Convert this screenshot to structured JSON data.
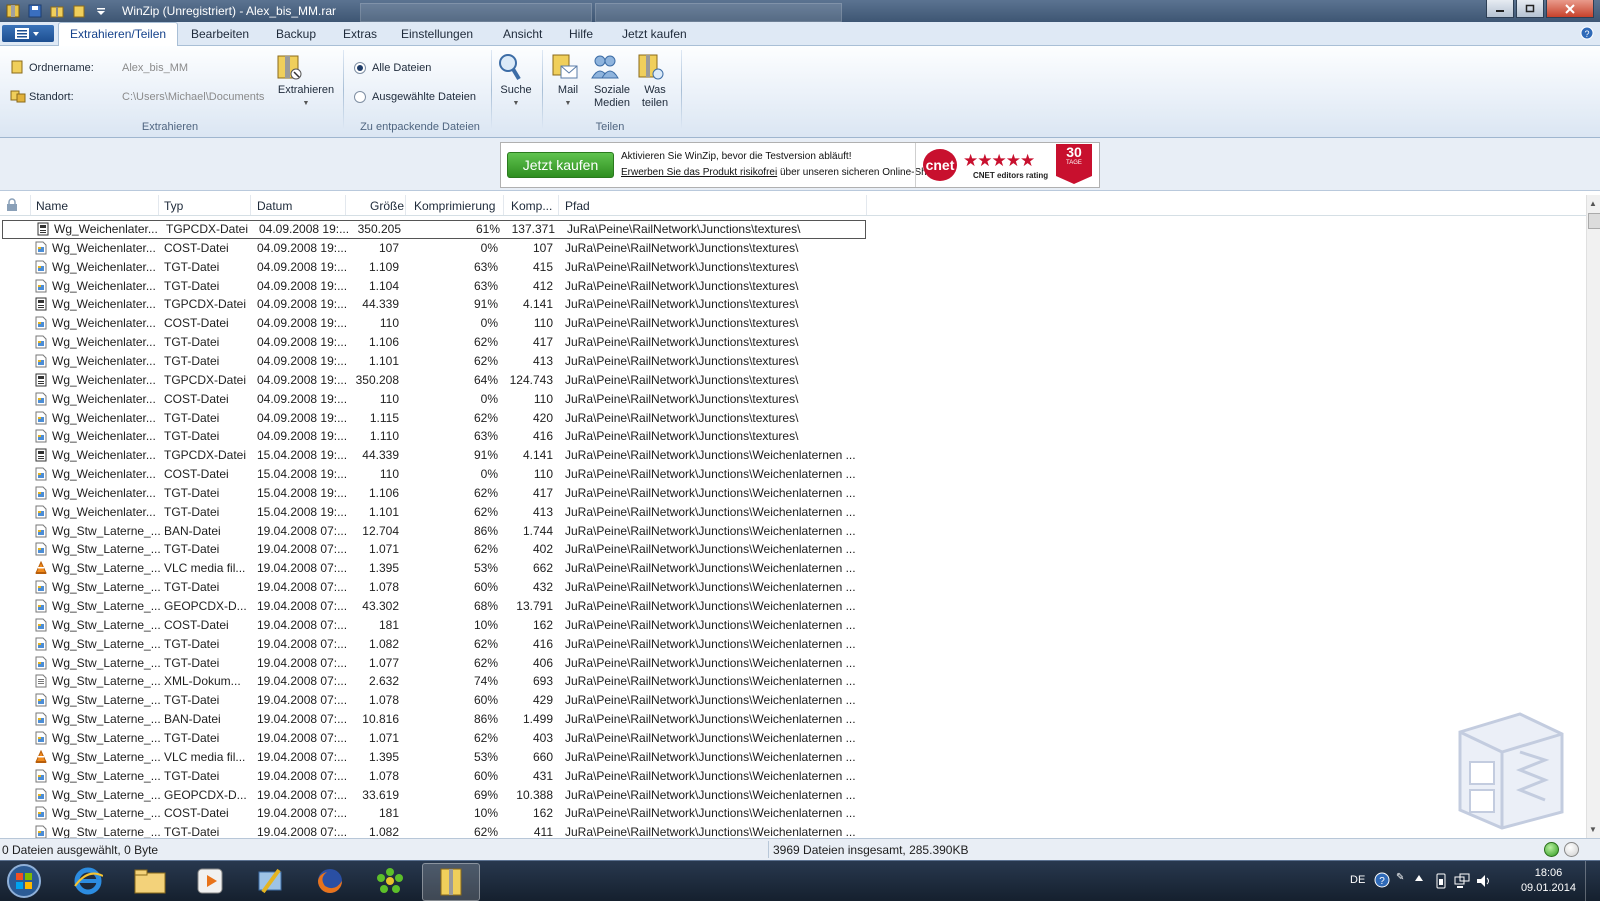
{
  "titlebar": {
    "title": "WinZip (Unregistriert) - Alex_bis_MM.rar"
  },
  "ribbon_tabs": [
    "Extrahieren/Teilen",
    "Bearbeiten",
    "Backup",
    "Extras",
    "Einstellungen",
    "Ansicht",
    "Hilfe",
    "Jetzt kaufen"
  ],
  "ribbon": {
    "ordnername_label": "Ordnername:",
    "ordnername_value": "Alex_bis_MM",
    "standort_label": "Standort:",
    "standort_value": "C:\\Users\\Michael\\Documents",
    "extract_button": "Extrahieren",
    "group_extract": "Extrahieren",
    "radio_all": "Alle Dateien",
    "radio_selected": "Ausgewählte Dateien",
    "group_files": "Zu entpackende Dateien",
    "search_button": "Suche",
    "mail_button": "Mail",
    "social_button_1": "Soziale",
    "social_button_2": "Medien",
    "share_button_1": "Was",
    "share_button_2": "teilen",
    "group_share": "Teilen"
  },
  "banner": {
    "buy_label": "Jetzt kaufen",
    "line1": "Aktivieren Sie WinZip, bevor die Testversion abläuft!",
    "line2_link": "Erwerben Sie das Produkt risikofrei",
    "line2_rest": " über unseren sicheren Online-Shop.",
    "cnet_logo": "cnet",
    "stars": "★★★★★",
    "cnet_rating": "CNET editors rating",
    "badge_number": "30",
    "badge_text": "TAGE"
  },
  "columns": [
    "Name",
    "Typ",
    "Datum",
    "Größe",
    "Komprimierung",
    "Komp...",
    "Pfad"
  ],
  "files": [
    {
      "icon": "tgpcdx",
      "name": "Wg_Weichenlater...",
      "type": "TGPCDX-Datei",
      "date": "04.09.2008 19:...",
      "size": "350.205",
      "ratio": "61%",
      "packed": "137.371",
      "path": "JuRa\\Peine\\RailNetwork\\Junctions\\textures\\"
    },
    {
      "icon": "generic",
      "name": "Wg_Weichenlater...",
      "type": "COST-Datei",
      "date": "04.09.2008 19:...",
      "size": "107",
      "ratio": "0%",
      "packed": "107",
      "path": "JuRa\\Peine\\RailNetwork\\Junctions\\textures\\"
    },
    {
      "icon": "generic",
      "name": "Wg_Weichenlater...",
      "type": "TGT-Datei",
      "date": "04.09.2008 19:...",
      "size": "1.109",
      "ratio": "63%",
      "packed": "415",
      "path": "JuRa\\Peine\\RailNetwork\\Junctions\\textures\\"
    },
    {
      "icon": "generic",
      "name": "Wg_Weichenlater...",
      "type": "TGT-Datei",
      "date": "04.09.2008 19:...",
      "size": "1.104",
      "ratio": "63%",
      "packed": "412",
      "path": "JuRa\\Peine\\RailNetwork\\Junctions\\textures\\"
    },
    {
      "icon": "tgpcdx",
      "name": "Wg_Weichenlater...",
      "type": "TGPCDX-Datei",
      "date": "04.09.2008 19:...",
      "size": "44.339",
      "ratio": "91%",
      "packed": "4.141",
      "path": "JuRa\\Peine\\RailNetwork\\Junctions\\textures\\"
    },
    {
      "icon": "generic",
      "name": "Wg_Weichenlater...",
      "type": "COST-Datei",
      "date": "04.09.2008 19:...",
      "size": "110",
      "ratio": "0%",
      "packed": "110",
      "path": "JuRa\\Peine\\RailNetwork\\Junctions\\textures\\"
    },
    {
      "icon": "generic",
      "name": "Wg_Weichenlater...",
      "type": "TGT-Datei",
      "date": "04.09.2008 19:...",
      "size": "1.106",
      "ratio": "62%",
      "packed": "417",
      "path": "JuRa\\Peine\\RailNetwork\\Junctions\\textures\\"
    },
    {
      "icon": "generic",
      "name": "Wg_Weichenlater...",
      "type": "TGT-Datei",
      "date": "04.09.2008 19:...",
      "size": "1.101",
      "ratio": "62%",
      "packed": "413",
      "path": "JuRa\\Peine\\RailNetwork\\Junctions\\textures\\"
    },
    {
      "icon": "tgpcdx",
      "name": "Wg_Weichenlater...",
      "type": "TGPCDX-Datei",
      "date": "04.09.2008 19:...",
      "size": "350.208",
      "ratio": "64%",
      "packed": "124.743",
      "path": "JuRa\\Peine\\RailNetwork\\Junctions\\textures\\"
    },
    {
      "icon": "generic",
      "name": "Wg_Weichenlater...",
      "type": "COST-Datei",
      "date": "04.09.2008 19:...",
      "size": "110",
      "ratio": "0%",
      "packed": "110",
      "path": "JuRa\\Peine\\RailNetwork\\Junctions\\textures\\"
    },
    {
      "icon": "generic",
      "name": "Wg_Weichenlater...",
      "type": "TGT-Datei",
      "date": "04.09.2008 19:...",
      "size": "1.115",
      "ratio": "62%",
      "packed": "420",
      "path": "JuRa\\Peine\\RailNetwork\\Junctions\\textures\\"
    },
    {
      "icon": "generic",
      "name": "Wg_Weichenlater...",
      "type": "TGT-Datei",
      "date": "04.09.2008 19:...",
      "size": "1.110",
      "ratio": "63%",
      "packed": "416",
      "path": "JuRa\\Peine\\RailNetwork\\Junctions\\textures\\"
    },
    {
      "icon": "tgpcdx",
      "name": "Wg_Weichenlater...",
      "type": "TGPCDX-Datei",
      "date": "15.04.2008 19:...",
      "size": "44.339",
      "ratio": "91%",
      "packed": "4.141",
      "path": "JuRa\\Peine\\RailNetwork\\Junctions\\Weichenlaternen ..."
    },
    {
      "icon": "generic",
      "name": "Wg_Weichenlater...",
      "type": "COST-Datei",
      "date": "15.04.2008 19:...",
      "size": "110",
      "ratio": "0%",
      "packed": "110",
      "path": "JuRa\\Peine\\RailNetwork\\Junctions\\Weichenlaternen ..."
    },
    {
      "icon": "generic",
      "name": "Wg_Weichenlater...",
      "type": "TGT-Datei",
      "date": "15.04.2008 19:...",
      "size": "1.106",
      "ratio": "62%",
      "packed": "417",
      "path": "JuRa\\Peine\\RailNetwork\\Junctions\\Weichenlaternen ..."
    },
    {
      "icon": "generic",
      "name": "Wg_Weichenlater...",
      "type": "TGT-Datei",
      "date": "15.04.2008 19:...",
      "size": "1.101",
      "ratio": "62%",
      "packed": "413",
      "path": "JuRa\\Peine\\RailNetwork\\Junctions\\Weichenlaternen ..."
    },
    {
      "icon": "generic",
      "name": "Wg_Stw_Laterne_...",
      "type": "BAN-Datei",
      "date": "19.04.2008 07:...",
      "size": "12.704",
      "ratio": "86%",
      "packed": "1.744",
      "path": "JuRa\\Peine\\RailNetwork\\Junctions\\Weichenlaternen ..."
    },
    {
      "icon": "generic",
      "name": "Wg_Stw_Laterne_...",
      "type": "TGT-Datei",
      "date": "19.04.2008 07:...",
      "size": "1.071",
      "ratio": "62%",
      "packed": "402",
      "path": "JuRa\\Peine\\RailNetwork\\Junctions\\Weichenlaternen ..."
    },
    {
      "icon": "vlc",
      "name": "Wg_Stw_Laterne_...",
      "type": "VLC media fil...",
      "date": "19.04.2008 07:...",
      "size": "1.395",
      "ratio": "53%",
      "packed": "662",
      "path": "JuRa\\Peine\\RailNetwork\\Junctions\\Weichenlaternen ..."
    },
    {
      "icon": "generic",
      "name": "Wg_Stw_Laterne_...",
      "type": "TGT-Datei",
      "date": "19.04.2008 07:...",
      "size": "1.078",
      "ratio": "60%",
      "packed": "432",
      "path": "JuRa\\Peine\\RailNetwork\\Junctions\\Weichenlaternen ..."
    },
    {
      "icon": "generic",
      "name": "Wg_Stw_Laterne_...",
      "type": "GEOPCDX-D...",
      "date": "19.04.2008 07:...",
      "size": "43.302",
      "ratio": "68%",
      "packed": "13.791",
      "path": "JuRa\\Peine\\RailNetwork\\Junctions\\Weichenlaternen ..."
    },
    {
      "icon": "generic",
      "name": "Wg_Stw_Laterne_...",
      "type": "COST-Datei",
      "date": "19.04.2008 07:...",
      "size": "181",
      "ratio": "10%",
      "packed": "162",
      "path": "JuRa\\Peine\\RailNetwork\\Junctions\\Weichenlaternen ..."
    },
    {
      "icon": "generic",
      "name": "Wg_Stw_Laterne_...",
      "type": "TGT-Datei",
      "date": "19.04.2008 07:...",
      "size": "1.082",
      "ratio": "62%",
      "packed": "416",
      "path": "JuRa\\Peine\\RailNetwork\\Junctions\\Weichenlaternen ..."
    },
    {
      "icon": "generic",
      "name": "Wg_Stw_Laterne_...",
      "type": "TGT-Datei",
      "date": "19.04.2008 07:...",
      "size": "1.077",
      "ratio": "62%",
      "packed": "406",
      "path": "JuRa\\Peine\\RailNetwork\\Junctions\\Weichenlaternen ..."
    },
    {
      "icon": "xml",
      "name": "Wg_Stw_Laterne_...",
      "type": "XML-Dokum...",
      "date": "19.04.2008 07:...",
      "size": "2.632",
      "ratio": "74%",
      "packed": "693",
      "path": "JuRa\\Peine\\RailNetwork\\Junctions\\Weichenlaternen ..."
    },
    {
      "icon": "generic",
      "name": "Wg_Stw_Laterne_...",
      "type": "TGT-Datei",
      "date": "19.04.2008 07:...",
      "size": "1.078",
      "ratio": "60%",
      "packed": "429",
      "path": "JuRa\\Peine\\RailNetwork\\Junctions\\Weichenlaternen ..."
    },
    {
      "icon": "generic",
      "name": "Wg_Stw_Laterne_...",
      "type": "BAN-Datei",
      "date": "19.04.2008 07:...",
      "size": "10.816",
      "ratio": "86%",
      "packed": "1.499",
      "path": "JuRa\\Peine\\RailNetwork\\Junctions\\Weichenlaternen ..."
    },
    {
      "icon": "generic",
      "name": "Wg_Stw_Laterne_...",
      "type": "TGT-Datei",
      "date": "19.04.2008 07:...",
      "size": "1.071",
      "ratio": "62%",
      "packed": "403",
      "path": "JuRa\\Peine\\RailNetwork\\Junctions\\Weichenlaternen ..."
    },
    {
      "icon": "vlc",
      "name": "Wg_Stw_Laterne_...",
      "type": "VLC media fil...",
      "date": "19.04.2008 07:...",
      "size": "1.395",
      "ratio": "53%",
      "packed": "660",
      "path": "JuRa\\Peine\\RailNetwork\\Junctions\\Weichenlaternen ..."
    },
    {
      "icon": "generic",
      "name": "Wg_Stw_Laterne_...",
      "type": "TGT-Datei",
      "date": "19.04.2008 07:...",
      "size": "1.078",
      "ratio": "60%",
      "packed": "431",
      "path": "JuRa\\Peine\\RailNetwork\\Junctions\\Weichenlaternen ..."
    },
    {
      "icon": "generic",
      "name": "Wg_Stw_Laterne_...",
      "type": "GEOPCDX-D...",
      "date": "19.04.2008 07:...",
      "size": "33.619",
      "ratio": "69%",
      "packed": "10.388",
      "path": "JuRa\\Peine\\RailNetwork\\Junctions\\Weichenlaternen ..."
    },
    {
      "icon": "generic",
      "name": "Wg_Stw_Laterne_...",
      "type": "COST-Datei",
      "date": "19.04.2008 07:...",
      "size": "181",
      "ratio": "10%",
      "packed": "162",
      "path": "JuRa\\Peine\\RailNetwork\\Junctions\\Weichenlaternen ..."
    },
    {
      "icon": "generic",
      "name": "Wg_Stw_Laterne_...",
      "type": "TGT-Datei",
      "date": "19.04.2008 07:...",
      "size": "1.082",
      "ratio": "62%",
      "packed": "411",
      "path": "JuRa\\Peine\\RailNetwork\\Junctions\\Weichenlaternen ..."
    }
  ],
  "status": {
    "left": "0 Dateien ausgewählt, 0 Byte",
    "right": "3969 Dateien insgesamt, 285.390KB"
  },
  "taskbar": {
    "language": "DE",
    "time": "18:06",
    "date": "09.01.2014"
  }
}
